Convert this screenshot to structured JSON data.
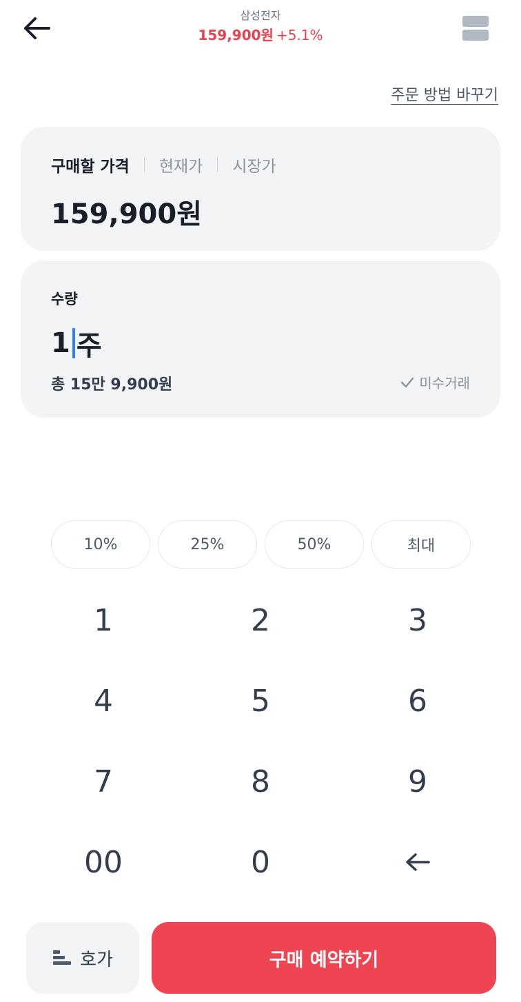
{
  "header": {
    "stock_name": "삼성전자",
    "stock_price": "159,900원",
    "stock_change": "+5.1%",
    "back_icon": "arrow-left-icon",
    "menu_icon": "layout-icon"
  },
  "change_order_label": "주문 방법 바꾸기",
  "price_card": {
    "tabs": [
      {
        "label": "구매할 가격",
        "active": true
      },
      {
        "label": "현재가",
        "active": false
      },
      {
        "label": "시장가",
        "active": false
      }
    ],
    "value": "159,900원"
  },
  "quantity_card": {
    "label": "수량",
    "value": "1",
    "unit": "주",
    "total": "총 15만 9,900원",
    "margin_trade": "미수거래",
    "margin_icon": "check-icon"
  },
  "percent_buttons": [
    "10%",
    "25%",
    "50%",
    "최대"
  ],
  "keypad": [
    "1",
    "2",
    "3",
    "4",
    "5",
    "6",
    "7",
    "8",
    "9",
    "00",
    "0"
  ],
  "keypad_backspace_icon": "backspace-arrow-icon",
  "bottom": {
    "hoga_label": "호가",
    "hoga_icon": "orderbook-icon",
    "buy_label": "구매 예약하기"
  },
  "colors": {
    "accent_red": "#ef4452",
    "price_red": "#e8414f",
    "cursor_blue": "#3182f6",
    "card_bg": "#f2f4f6"
  }
}
